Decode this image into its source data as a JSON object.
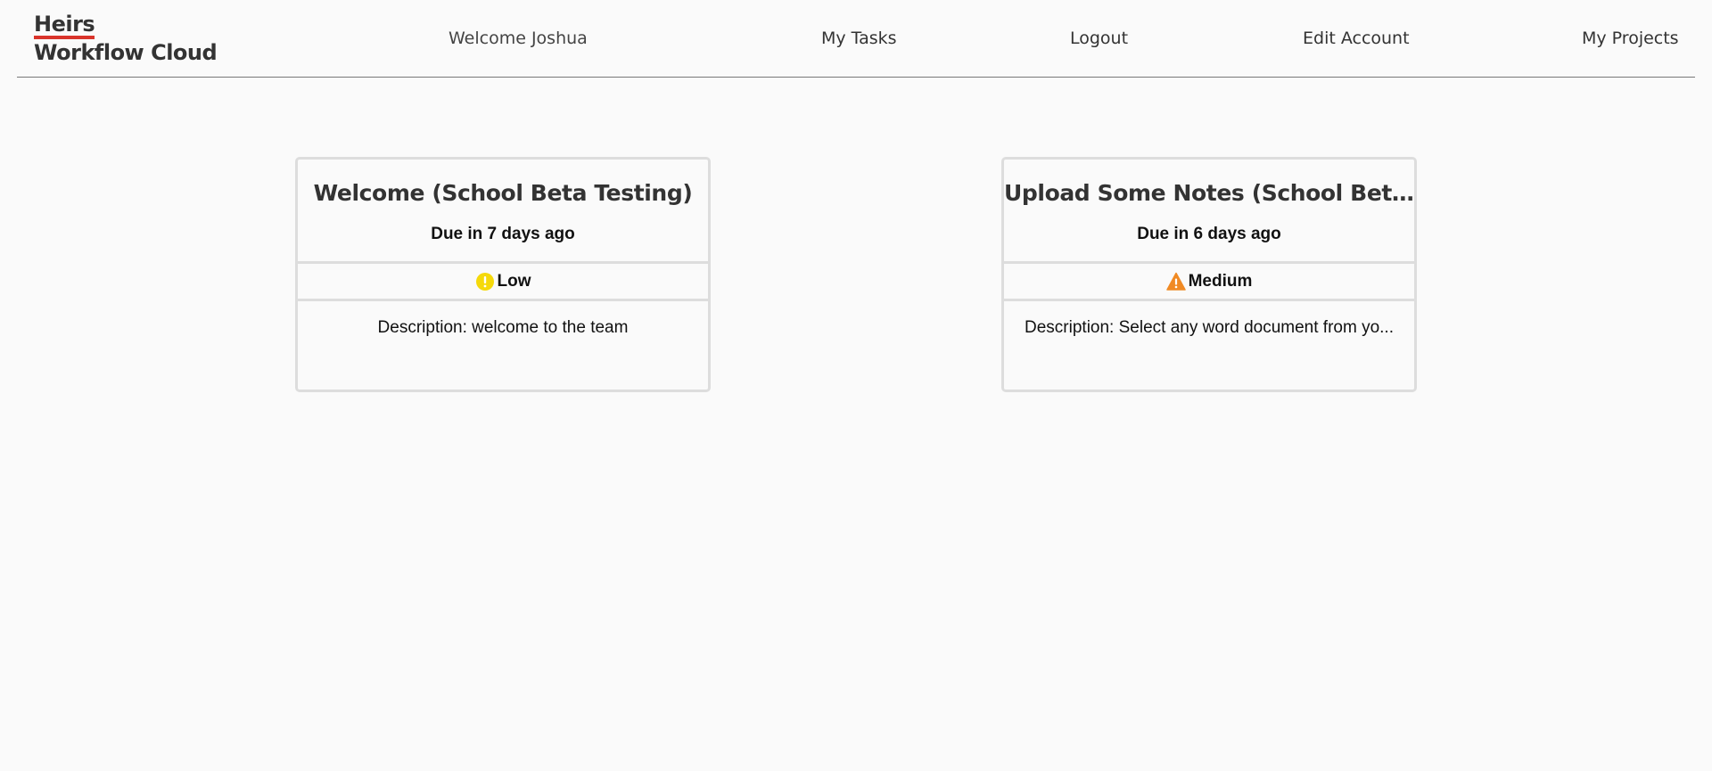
{
  "brand": {
    "line1": "Heirs",
    "line2": "Workflow Cloud",
    "accent_color": "#d9342b"
  },
  "nav": {
    "welcome": "Welcome Joshua",
    "my_tasks": "My Tasks",
    "logout": "Logout",
    "edit_account": "Edit Account",
    "my_projects": "My Projects"
  },
  "tasks": [
    {
      "title": "Welcome (School Beta Testing)",
      "due": "Due in 7 days ago",
      "priority": "Low",
      "priority_icon": "exclamation-circle-icon",
      "priority_color": "#f5d90a",
      "description": "Description: welcome to the team"
    },
    {
      "title": "Upload Some Notes (School Beta ...",
      "due": "Due in 6 days ago",
      "priority": "Medium",
      "priority_icon": "warning-triangle-icon",
      "priority_color": "#f08a24",
      "description": "Description: Select any word document from yo..."
    }
  ]
}
